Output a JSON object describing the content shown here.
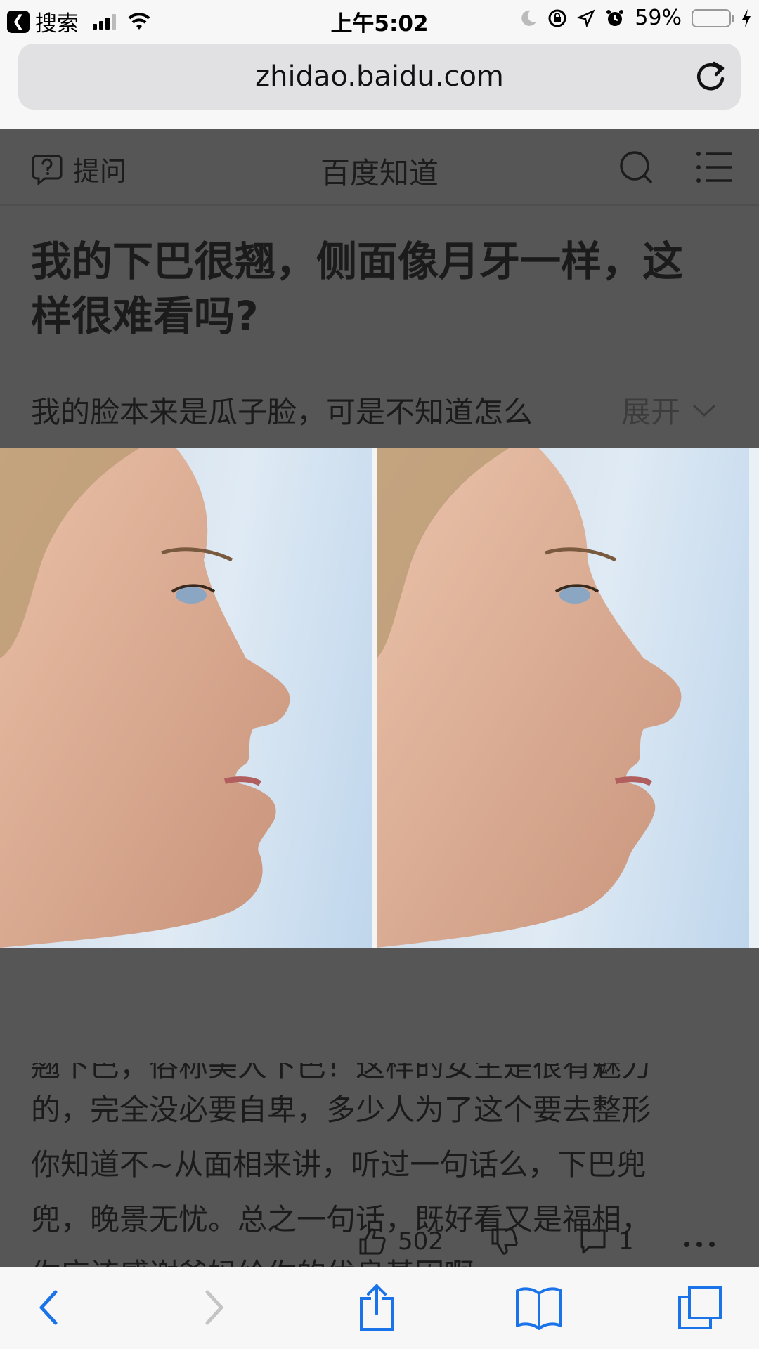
{
  "status_bar": {
    "back_app": "搜索",
    "time": "上午5:02",
    "battery_percent": "59%",
    "battery_level": 0.59
  },
  "browser": {
    "url": "zhidao.baidu.com"
  },
  "header": {
    "ask_label": "提问",
    "site_title": "百度知道"
  },
  "question": {
    "title": "我的下巴很翘，侧面像月牙一样，这样很难看吗?",
    "description": "我的脸本来是瓜子脸，可是不知道怎么",
    "expand_label": "展开"
  },
  "answer": {
    "lines": [
      "翘下巴，俗称美人下巴！这样的女生是很有魅力",
      "的，完全没必要自卑，多少人为了这个要去整形",
      "你知道不~从面相来讲，听过一句话么，下巴兜",
      "兜，晚景无忧。总之一句话，既好看又是福相，",
      "你应该感谢爸妈给你的优良基因啊。"
    ]
  },
  "actions": {
    "likes": "502",
    "comments": "1"
  },
  "icons": {
    "back": "chevron-left-icon",
    "forward": "chevron-right-icon",
    "share": "share-icon",
    "bookmarks": "book-icon",
    "tabs": "tabs-icon"
  }
}
